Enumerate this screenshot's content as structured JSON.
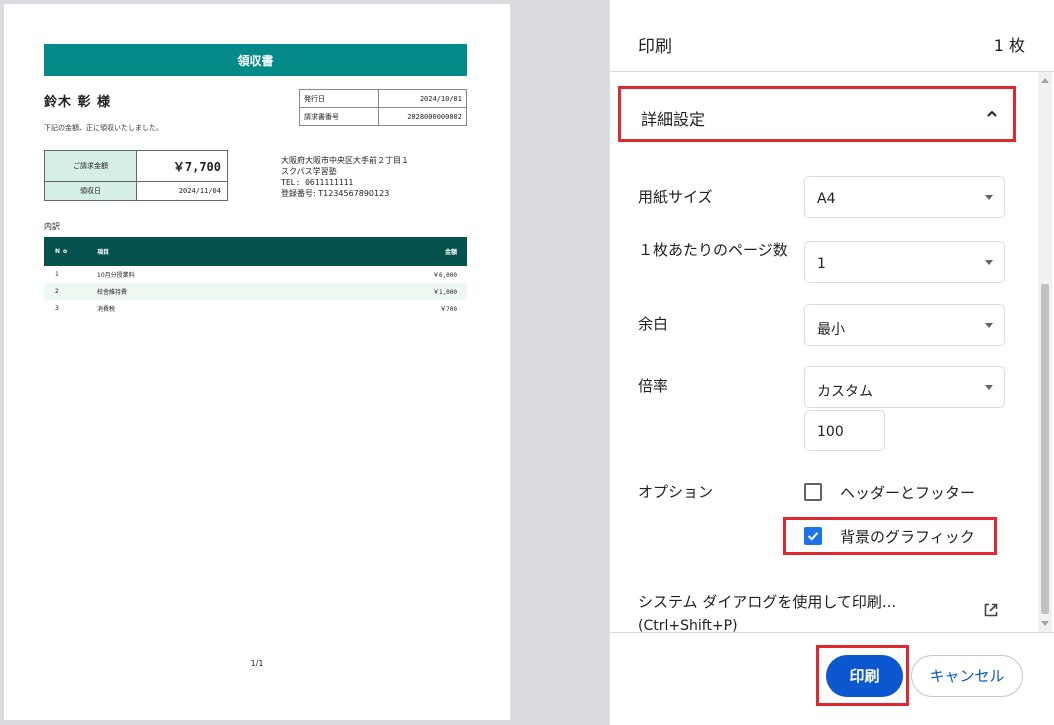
{
  "preview": {
    "receipt_title": "領収書",
    "customer": "鈴木 彰 様",
    "note": "下記の金額、正に領収いたしました。",
    "meta": [
      {
        "label": "発行日",
        "value": "2024/10/01"
      },
      {
        "label": "請求書番号",
        "value": "2028000000002"
      }
    ],
    "amount": {
      "label": "ご請求金額",
      "value": "￥7,700"
    },
    "receipt_date": {
      "label": "領収日",
      "value": "2024/11/04"
    },
    "address": {
      "line1": "大阪府大阪市中央区大手前２丁目１",
      "line2": "スクパス学習塾",
      "tel": "TEL: 0611111111",
      "reg": "登録番号: T1234567890123"
    },
    "breakdown_title": "内訳",
    "table": {
      "headers": {
        "no": "No",
        "item": "項目",
        "amount": "金額"
      },
      "rows": [
        {
          "no": "1",
          "item": "10月分授業料",
          "amount": "￥6,000"
        },
        {
          "no": "2",
          "item": "校舎維持費",
          "amount": "￥1,000"
        },
        {
          "no": "3",
          "item": "消費税",
          "amount": "￥700"
        }
      ]
    },
    "page_number": "1/1"
  },
  "panel": {
    "title": "印刷",
    "sheets": "1 枚",
    "advanced": "詳細設定",
    "paper_size": {
      "label": "用紙サイズ",
      "value": "A4"
    },
    "pages_per_sheet": {
      "label": "１枚あたりのページ数",
      "value": "1"
    },
    "margins": {
      "label": "余白",
      "value": "最小"
    },
    "scale": {
      "label": "倍率",
      "value": "カスタム",
      "custom_value": "100"
    },
    "options": {
      "label": "オプション",
      "headers_footers": {
        "label": "ヘッダーとフッター",
        "checked": false
      },
      "background_graphics": {
        "label": "背景のグラフィック",
        "checked": true
      }
    },
    "system_dialog": {
      "line1": "システム ダイアログを使用して印刷...",
      "line2": "(Ctrl+Shift+P)"
    },
    "print_button": "印刷",
    "cancel_button": "キャンセル"
  },
  "colors": {
    "accent": "#0b57d0",
    "highlight": "#e0282e",
    "receipt_header": "#058a8a",
    "table_header": "#03524e"
  }
}
